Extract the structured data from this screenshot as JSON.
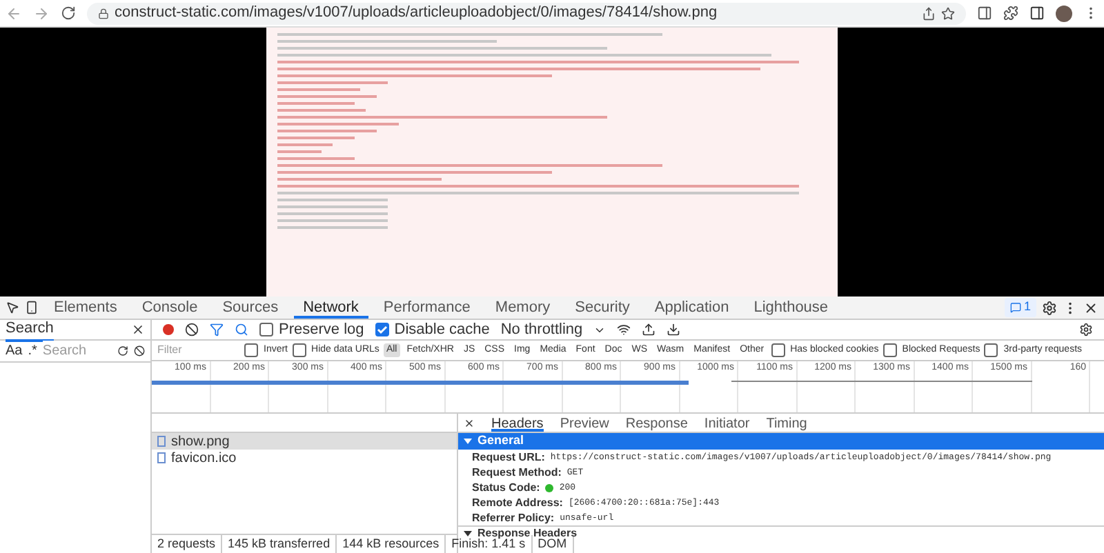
{
  "browser": {
    "url": "construct-static.com/images/v1007/uploads/articleuploadobject/0/images/78414/show.png"
  },
  "devtools": {
    "tabs": [
      {
        "label": "Elements",
        "selected": false
      },
      {
        "label": "Console",
        "selected": false
      },
      {
        "label": "Sources",
        "selected": false
      },
      {
        "label": "Network",
        "selected": true
      },
      {
        "label": "Performance",
        "selected": false
      },
      {
        "label": "Memory",
        "selected": false
      },
      {
        "label": "Security",
        "selected": false
      },
      {
        "label": "Application",
        "selected": false
      },
      {
        "label": "Lighthouse",
        "selected": false
      }
    ],
    "issues_count": "1"
  },
  "search_panel": {
    "title": "Search",
    "case_toggle": "Aa",
    "regex_toggle": ".*",
    "placeholder": "Search"
  },
  "toolbar": {
    "preserve_log": {
      "label": "Preserve log",
      "checked": false
    },
    "disable_cache": {
      "label": "Disable cache",
      "checked": true
    },
    "throttling": "No throttling"
  },
  "filter_bar": {
    "placeholder": "Filter",
    "invert": {
      "label": "Invert",
      "checked": false
    },
    "hide_data_urls": {
      "label": "Hide data URLs",
      "checked": false
    },
    "types": [
      {
        "label": "All",
        "selected": true
      },
      {
        "label": "Fetch/XHR",
        "selected": false
      },
      {
        "label": "JS",
        "selected": false
      },
      {
        "label": "CSS",
        "selected": false
      },
      {
        "label": "Img",
        "selected": false
      },
      {
        "label": "Media",
        "selected": false
      },
      {
        "label": "Font",
        "selected": false
      },
      {
        "label": "Doc",
        "selected": false
      },
      {
        "label": "WS",
        "selected": false
      },
      {
        "label": "Wasm",
        "selected": false
      },
      {
        "label": "Manifest",
        "selected": false
      },
      {
        "label": "Other",
        "selected": false
      }
    ],
    "options": [
      {
        "label": "Has blocked cookies",
        "checked": false
      },
      {
        "label": "Blocked Requests",
        "checked": false
      },
      {
        "label": "3rd-party requests",
        "checked": false
      }
    ]
  },
  "timeline": {
    "ticks": [
      "100 ms",
      "200 ms",
      "300 ms",
      "400 ms",
      "500 ms",
      "600 ms",
      "700 ms",
      "800 ms",
      "900 ms",
      "1000 ms",
      "1100 ms",
      "1200 ms",
      "1300 ms",
      "1400 ms",
      "1500 ms",
      "160"
    ]
  },
  "requests": [
    {
      "name": "show.png",
      "selected": true
    },
    {
      "name": "favicon.ico",
      "selected": false
    }
  ],
  "status_bar": [
    "2 requests",
    "145 kB transferred",
    "144 kB resources",
    "Finish: 1.41 s",
    "DOM"
  ],
  "details": {
    "tabs": [
      {
        "label": "Headers",
        "selected": true
      },
      {
        "label": "Preview",
        "selected": false
      },
      {
        "label": "Response",
        "selected": false
      },
      {
        "label": "Initiator",
        "selected": false
      },
      {
        "label": "Timing",
        "selected": false
      }
    ],
    "general": {
      "title": "General",
      "expanded": true,
      "rows": [
        {
          "label": "Request URL:",
          "value": "https://construct-static.com/images/v1007/uploads/articleuploadobject/0/images/78414/show.png"
        },
        {
          "label": "Request Method:",
          "value": "GET"
        },
        {
          "label": "Status Code:",
          "value": "200",
          "kind": "status"
        },
        {
          "label": "Remote Address:",
          "value": "[2606:4700:20::681a:75e]:443"
        },
        {
          "label": "Referrer Policy:",
          "value": "unsafe-url"
        }
      ]
    },
    "response_headers": {
      "title": "Response Headers",
      "expanded": true
    }
  }
}
